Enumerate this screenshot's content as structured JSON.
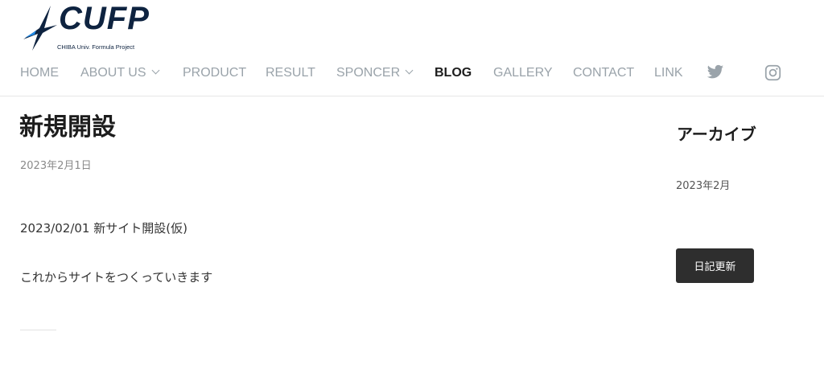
{
  "logo": {
    "text": "CUFP",
    "subtitle": "CHIBA Univ. Formula Project"
  },
  "nav": {
    "items": [
      {
        "label": "HOME"
      },
      {
        "label": "ABOUT US"
      },
      {
        "label": "PRODUCT"
      },
      {
        "label": "RESULT"
      },
      {
        "label": "SPONCER"
      },
      {
        "label": "BLOG"
      },
      {
        "label": "GALLERY"
      },
      {
        "label": "CONTACT"
      },
      {
        "label": "LINK"
      }
    ],
    "active": "BLOG",
    "social": [
      "twitter-icon",
      "instagram-icon"
    ]
  },
  "post": {
    "title": "新規開設",
    "date": "2023年2月1日",
    "line1": "2023/02/01 新サイト開設(仮)",
    "line2": "これからサイトをつくっていきます"
  },
  "sidebar": {
    "title": "アーカイブ",
    "archive_item": "2023年2月",
    "button_label": "日記更新"
  },
  "colors": {
    "nav": "#9aa3aa",
    "active": "#1c1c1c",
    "button": "#2e2e2e",
    "brand": "#0e2340"
  }
}
